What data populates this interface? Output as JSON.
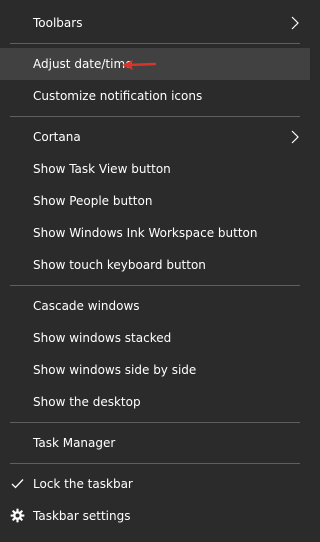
{
  "menu": {
    "items": [
      {
        "label": "Toolbars"
      },
      {
        "label": "Adjust date/time"
      },
      {
        "label": "Customize notification icons"
      },
      {
        "label": "Cortana"
      },
      {
        "label": "Show Task View button"
      },
      {
        "label": "Show People button"
      },
      {
        "label": "Show Windows Ink Workspace button"
      },
      {
        "label": "Show touch keyboard button"
      },
      {
        "label": "Cascade windows"
      },
      {
        "label": "Show windows stacked"
      },
      {
        "label": "Show windows side by side"
      },
      {
        "label": "Show the desktop"
      },
      {
        "label": "Task Manager"
      },
      {
        "label": "Lock the taskbar",
        "checked": true
      },
      {
        "label": "Taskbar settings",
        "icon": "gear-icon"
      }
    ]
  },
  "annotation": {
    "color": "#d9342b",
    "icon": "red-arrow-icon"
  },
  "colors": {
    "background": "#2b2b2b",
    "highlight": "#414141",
    "separator": "#5f5f5f",
    "text": "#ffffff"
  }
}
